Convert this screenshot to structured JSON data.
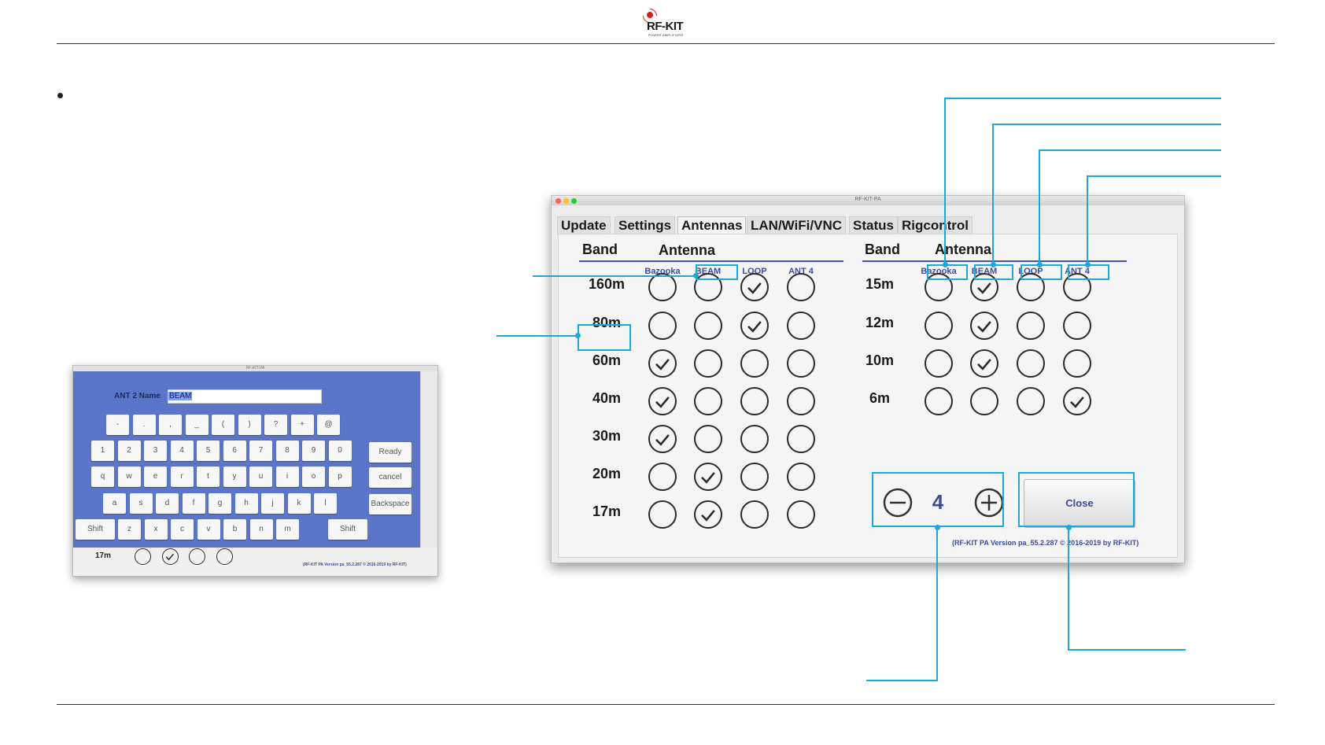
{
  "logo": {
    "text": "RF-KIT",
    "sub": "POWER AMPLIFIERS"
  },
  "keyboard_window": {
    "field_label": "ANT 2 Name",
    "field_value": "BEAM",
    "row1": [
      "-",
      ".",
      ",",
      "_",
      "(",
      ")",
      "?",
      "+",
      "@"
    ],
    "row2": [
      "1",
      "2",
      "3",
      "4",
      "5",
      "6",
      "7",
      "8",
      "9",
      "0"
    ],
    "row3": [
      "q",
      "w",
      "e",
      "r",
      "t",
      "y",
      "u",
      "i",
      "o",
      "p"
    ],
    "row4": [
      "a",
      "s",
      "d",
      "f",
      "g",
      "h",
      "j",
      "k",
      "l"
    ],
    "row5": [
      "z",
      "x",
      "c",
      "v",
      "b",
      "n",
      "m"
    ],
    "shift_label": "Shift",
    "ready_label": "Ready",
    "cancel_label": "cancel",
    "backspace_label": "Backspace",
    "bottom_band": "17m",
    "bottom_checks": [
      false,
      true,
      false,
      false
    ],
    "version": "(RF-KIT PA Version pa_55.2.287 © 2016-2019 by RF-KIT)"
  },
  "main_window": {
    "title": "RF-KIT-PA",
    "tabs": [
      "Update",
      "Settings",
      "Antennas",
      "LAN/WiFi/VNC",
      "Status",
      "Rigcontrol"
    ],
    "active_tab": "Antennas",
    "band_header": "Band",
    "antenna_header": "Antenna",
    "antenna_names": [
      "Bazooka",
      "BEAM",
      "LOOP",
      "ANT 4"
    ],
    "left_bands": [
      {
        "band": "160m",
        "checks": [
          false,
          false,
          true,
          false
        ]
      },
      {
        "band": "80m",
        "checks": [
          false,
          false,
          true,
          false
        ]
      },
      {
        "band": "60m",
        "checks": [
          true,
          false,
          false,
          false
        ]
      },
      {
        "band": "40m",
        "checks": [
          true,
          false,
          false,
          false
        ]
      },
      {
        "band": "30m",
        "checks": [
          true,
          false,
          false,
          false
        ]
      },
      {
        "band": "20m",
        "checks": [
          false,
          true,
          false,
          false
        ]
      },
      {
        "band": "17m",
        "checks": [
          false,
          true,
          false,
          false
        ]
      }
    ],
    "right_bands": [
      {
        "band": "15m",
        "checks": [
          false,
          true,
          false,
          false
        ]
      },
      {
        "band": "12m",
        "checks": [
          false,
          true,
          false,
          false
        ]
      },
      {
        "band": "10m",
        "checks": [
          false,
          true,
          false,
          false
        ]
      },
      {
        "band": "6m",
        "checks": [
          false,
          false,
          false,
          true
        ]
      }
    ],
    "stepper_value": "4",
    "close_label": "Close",
    "version": "(RF-KIT PA Version pa_55.2.287 © 2016-2019 by RF-KIT)"
  },
  "colors": {
    "accent": "#3b4aa0",
    "callout": "#1ba9d8",
    "keyboard_bg": "#5b76c8"
  }
}
